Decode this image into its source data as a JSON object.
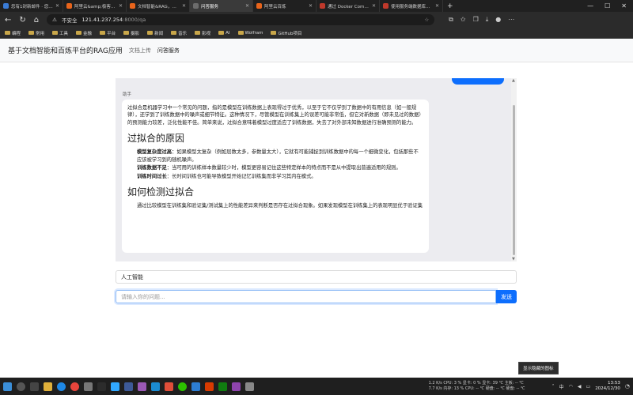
{
  "browser": {
    "tabs": [
      {
        "title": "您有1封新邮件 · 您有1封",
        "color": "#3a7bd5",
        "active": false
      },
      {
        "title": "阿里云&amp;极客时间",
        "color": "#e8641b",
        "active": false
      },
      {
        "title": "文档智能&RAG，让你的",
        "color": "#e8641b",
        "active": false
      },
      {
        "title": "问答服务",
        "color": "#6c6c6c",
        "active": true
      },
      {
        "title": "阿里云百炼",
        "color": "#e8641b",
        "active": false
      },
      {
        "title": "通过 Docker Compose 部",
        "color": "#c0392b",
        "active": false
      },
      {
        "title": "使用服务端数据库部署",
        "color": "#c0392b",
        "active": false
      }
    ],
    "insecure_label": "不安全",
    "url_host": "121.41.237.254",
    "url_path": ":8000/qa",
    "bookmarks": [
      "编程",
      "常用",
      "工具",
      "金融",
      "平台",
      "摄影",
      "新闻",
      "音乐",
      "影视",
      "AI",
      "Wolfram",
      "GitHub项目"
    ]
  },
  "app": {
    "brand": "基于文档智能和百炼平台的RAG应用",
    "nav": [
      "文档上传",
      "问答服务"
    ]
  },
  "chat": {
    "sender": "助手",
    "intro": "过拟合是机器学习中一个常见的问题，指的是模型在训练数据上表现得过于优秀，以至于它不仅学到了数据中的有用信息（如一般规律），还学到了训练数据中的噪声或细节特征。这种情况下，尽管模型在训练集上的误差可能非常低，但它对新数据（即未见过的数据）的预测能力较差，泛化性能不佳。简单来说，过拟合意味着模型过度适应了训练数据，失去了对外部未知数据进行准确预测的能力。",
    "h1": "过拟合的原因",
    "causes": [
      {
        "label": "模型复杂度过高",
        "text": "：如果模型太复杂（例如层数太多，参数量太大），它就有可能捕捉到训练数据中的每一个细微变化，包括那些不应该被学习到的随机噪声。"
      },
      {
        "label": "训练数据不足",
        "text": "：当可用的训练样本数量较少时，模型更容易记住这些特定样本的特点而不是从中提取出普遍适用的规则。"
      },
      {
        "label": "训练时间过长",
        "text": "：长时间训练也可能导致模型开始记忆训练集而非学习其内在模式。"
      }
    ],
    "h2": "如何检测过拟合",
    "detect": "通过比较模型在训练集和验证集/测试集上的性能差异来判断是否存在过拟合现象。如果发现模型在训练集上的表现明显优于验证集"
  },
  "form": {
    "knowledge_base_value": "人工智能",
    "question_placeholder": "请输入你的问题...",
    "send_label": "发送"
  },
  "tooltip": "显示隐藏的图标",
  "taskbar": {
    "stats_line1": "1.2 K/s CPU:  3 % 显卡:  0 % 显卡: 39 ℃ 主板: -- ℃",
    "stats_line2": "7.7 K/s 内存: 13 % CPU: -- ℃ 硬盘: -- ℃ 硬盘: -- ℃",
    "lang": "中",
    "time": "13:53",
    "date": "2024/12/30"
  }
}
